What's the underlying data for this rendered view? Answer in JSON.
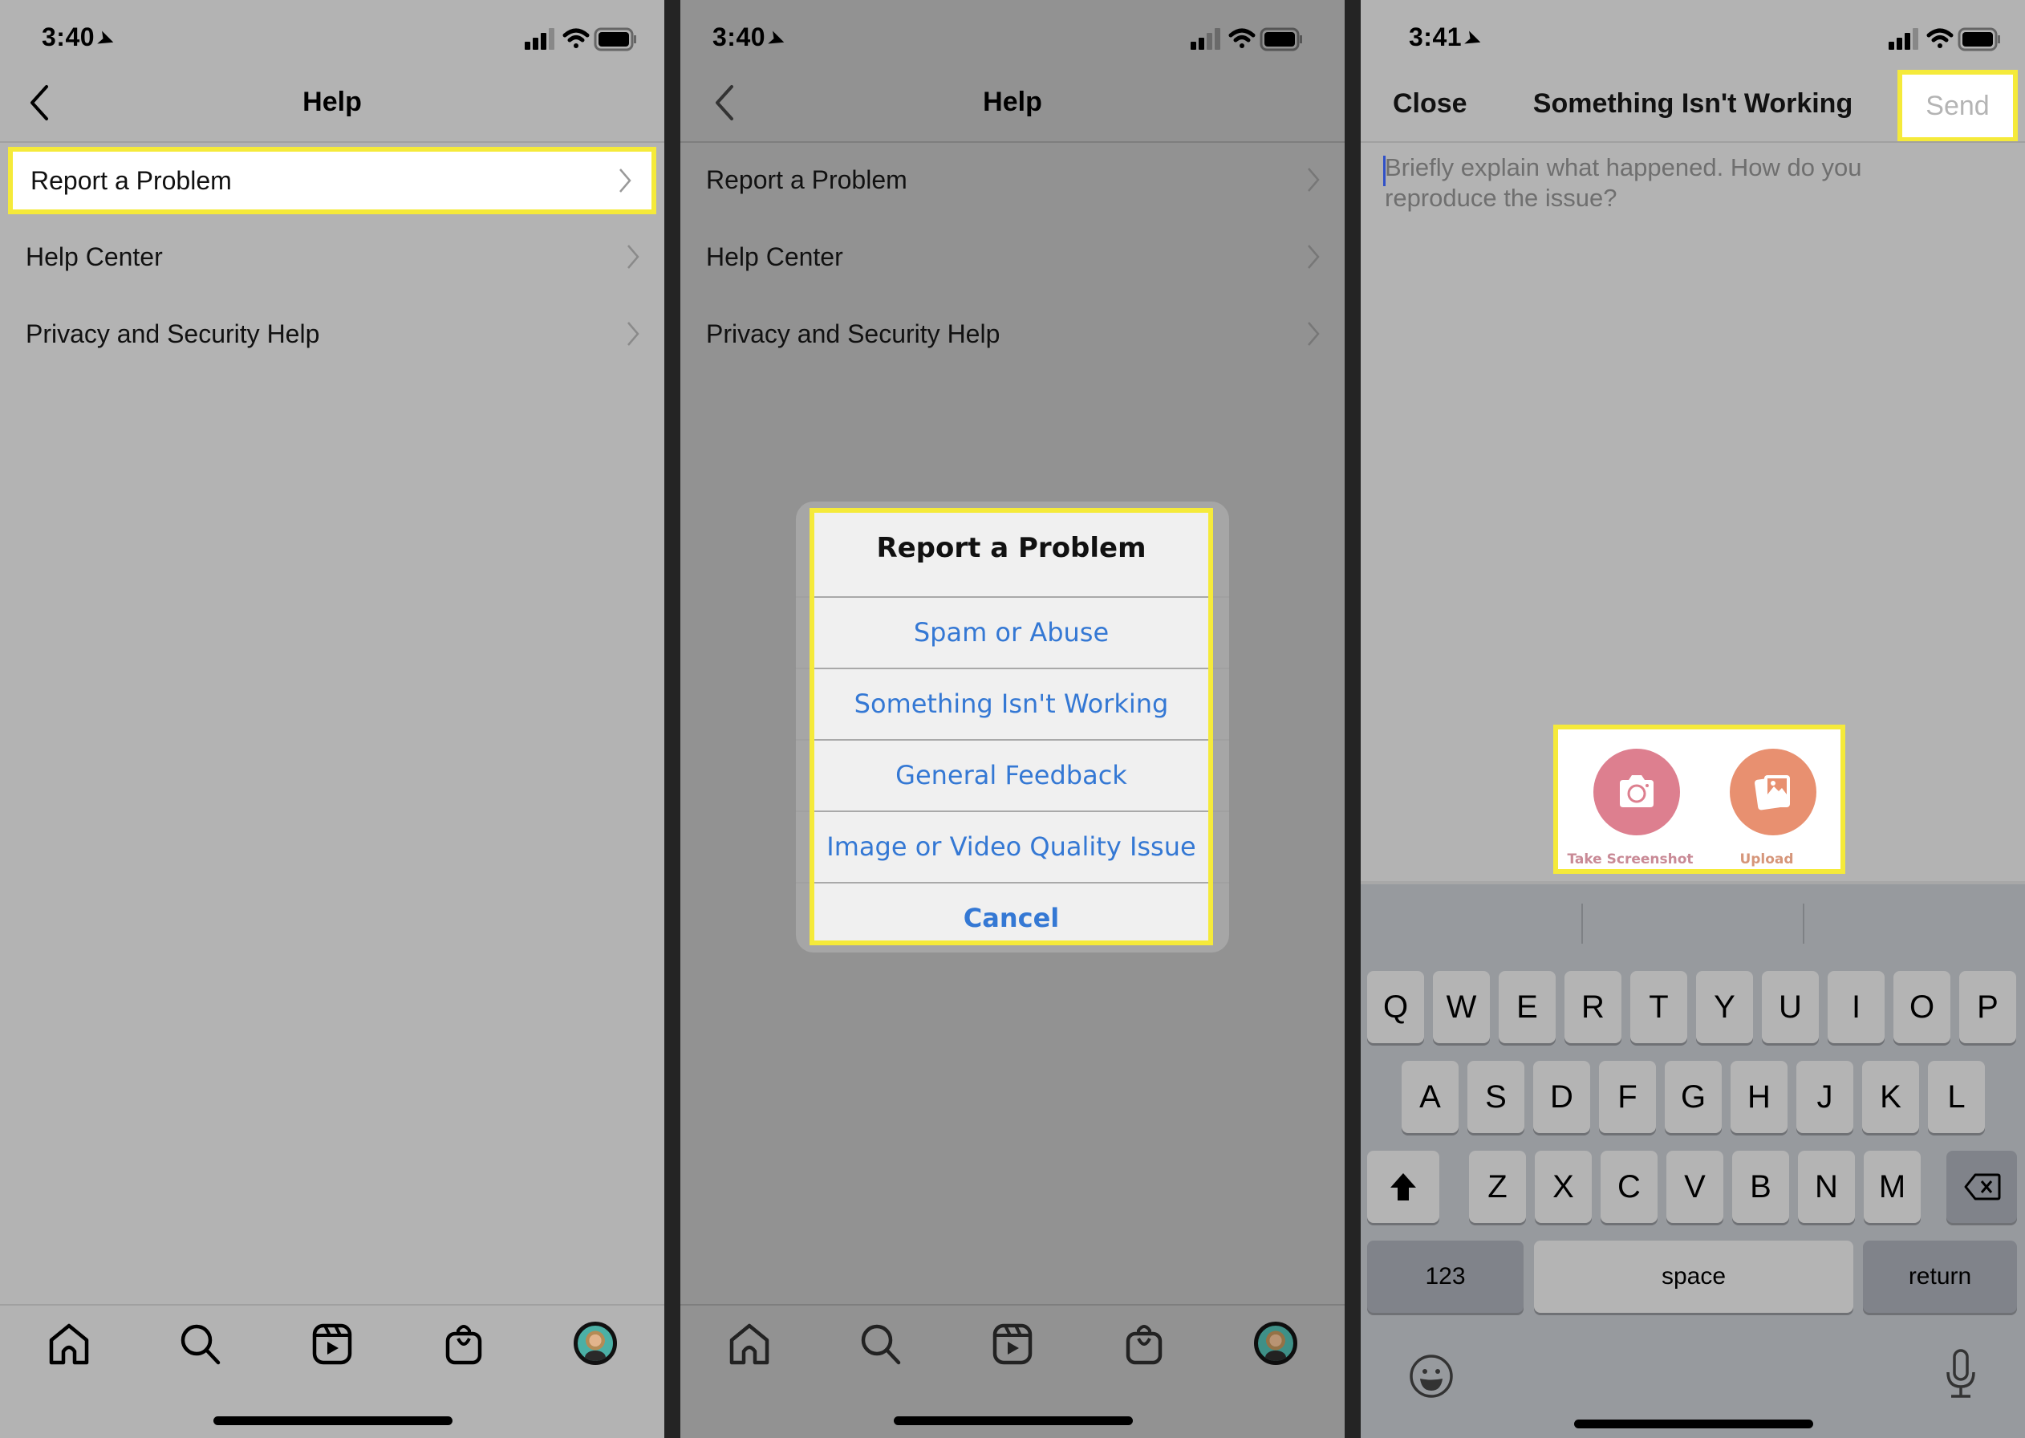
{
  "panels": {
    "help": {
      "status": {
        "time": "3:40"
      },
      "nav": {
        "title": "Help"
      },
      "menu": [
        {
          "label": "Report a Problem",
          "highlighted": true
        },
        {
          "label": "Help Center"
        },
        {
          "label": "Privacy and Security Help"
        }
      ],
      "tabbar": [
        "home-icon",
        "search-icon",
        "reels-icon",
        "shop-icon",
        "profile-avatar"
      ]
    },
    "dialog_screen": {
      "status": {
        "time": "3:40"
      },
      "nav": {
        "title": "Help"
      },
      "menu": [
        {
          "label": "Report a Problem"
        },
        {
          "label": "Help Center"
        },
        {
          "label": "Privacy and Security Help"
        }
      ],
      "dialog": {
        "title": "Report a Problem",
        "options": [
          "Spam or Abuse",
          "Something Isn't Working",
          "General Feedback",
          "Image or Video Quality Issue"
        ],
        "cancel": "Cancel",
        "option_color": "#3478d4"
      }
    },
    "report_form": {
      "status": {
        "time": "3:41"
      },
      "nav": {
        "close": "Close",
        "title": "Something Isn't Working",
        "send": "Send"
      },
      "textarea": {
        "placeholder": "Briefly explain what happened. How do you reproduce the issue?",
        "value": ""
      },
      "attachments": [
        {
          "label": "Take Screenshot",
          "icon": "camera-icon",
          "color": "#dd7f8f"
        },
        {
          "label": "Upload",
          "icon": "gallery-icon",
          "color": "#e89070"
        }
      ],
      "keyboard": {
        "row1": [
          "Q",
          "W",
          "E",
          "R",
          "T",
          "Y",
          "U",
          "I",
          "O",
          "P"
        ],
        "row2": [
          "A",
          "S",
          "D",
          "F",
          "G",
          "H",
          "J",
          "K",
          "L"
        ],
        "row3": [
          "Z",
          "X",
          "C",
          "V",
          "B",
          "N",
          "M"
        ],
        "numbers": "123",
        "space": "space",
        "return": "return"
      }
    }
  },
  "highlight_color": "#f5ea3a"
}
